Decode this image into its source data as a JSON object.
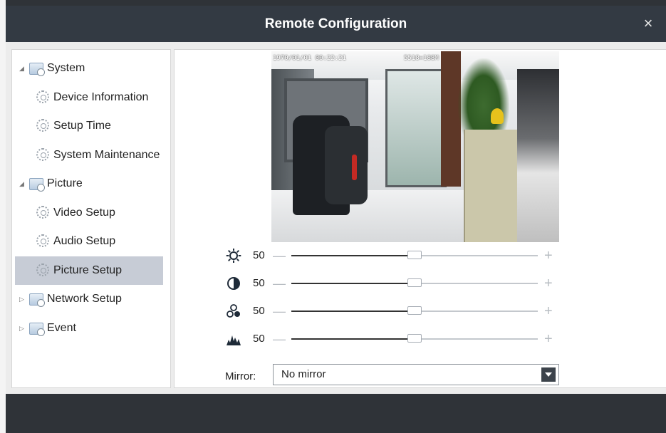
{
  "dialog": {
    "title": "Remote Configuration",
    "close_symbol": "×",
    "close_icon": "close-icon"
  },
  "tree": {
    "items": [
      {
        "label": "System",
        "type": "group",
        "icon": "folder-settings-icon",
        "expanded": true
      },
      {
        "label": "Device Information",
        "type": "child",
        "icon": "gear-icon"
      },
      {
        "label": "Setup Time",
        "type": "child",
        "icon": "gear-icon"
      },
      {
        "label": "System Maintenance",
        "type": "child",
        "icon": "gear-icon"
      },
      {
        "label": "Picture",
        "type": "group",
        "icon": "folder-settings-icon",
        "expanded": true
      },
      {
        "label": "Video Setup",
        "type": "child",
        "icon": "gear-icon"
      },
      {
        "label": "Audio Setup",
        "type": "child",
        "icon": "gear-icon"
      },
      {
        "label": "Picture Setup",
        "type": "child",
        "icon": "gear-icon",
        "selected": true
      },
      {
        "label": "Network Setup",
        "type": "group",
        "icon": "folder-settings-icon",
        "expanded": false
      },
      {
        "label": "Event",
        "type": "group",
        "icon": "folder-settings-icon",
        "expanded": false
      }
    ],
    "expanded_symbol": "◢",
    "collapsed_symbol": "▷"
  },
  "preview": {
    "osd_time": "1970/01/01 00:22:21",
    "osd_text": "5518=188M"
  },
  "adjustments": [
    {
      "name": "brightness",
      "icon": "brightness-icon",
      "value": "50",
      "level": 0.5
    },
    {
      "name": "contrast",
      "icon": "contrast-icon",
      "value": "50",
      "level": 0.5
    },
    {
      "name": "saturation",
      "icon": "saturation-icon",
      "value": "50",
      "level": 0.5
    },
    {
      "name": "sharpness",
      "icon": "sharpness-icon",
      "value": "50",
      "level": 0.5
    }
  ],
  "controls": {
    "minus": "—",
    "plus": "+"
  },
  "mirror": {
    "label": "Mirror:",
    "value": "No mirror"
  },
  "colors": {
    "title_bar": "#333a43",
    "selected_item": "#c7ccd6",
    "page_background": "#2f3338"
  }
}
